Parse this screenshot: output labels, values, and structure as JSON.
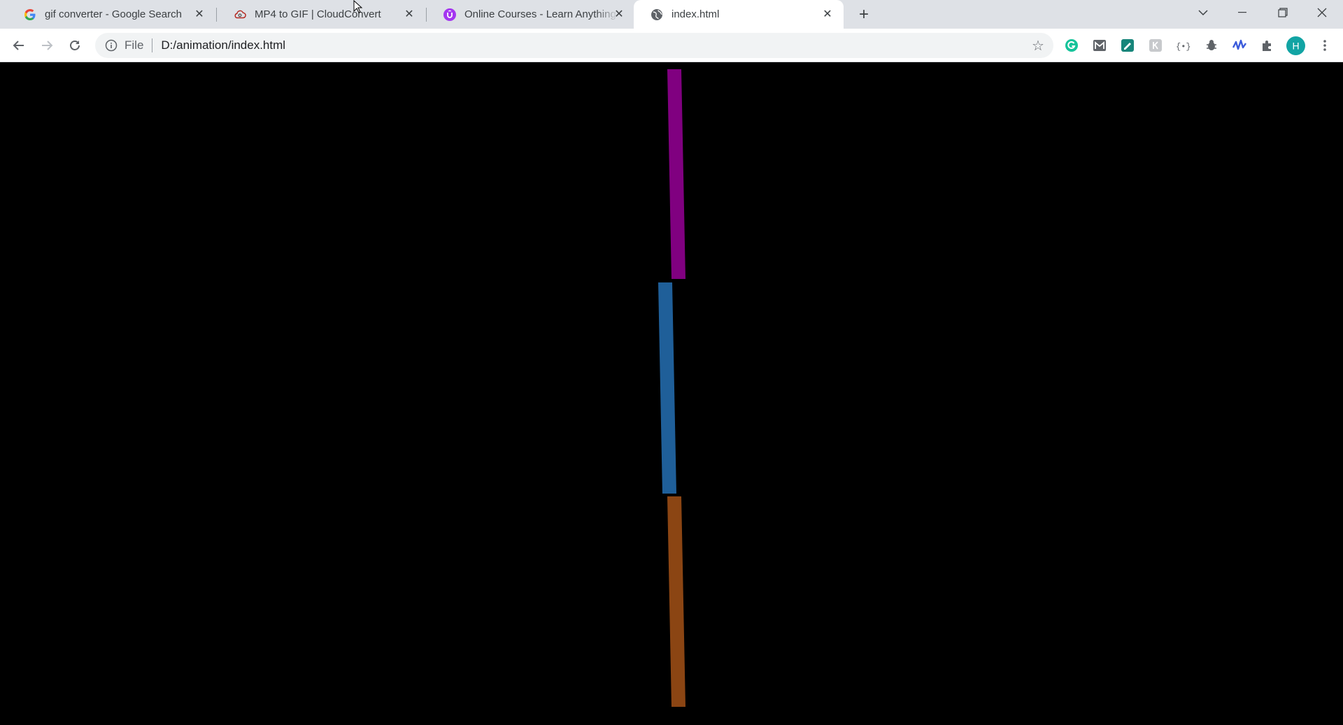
{
  "tabs": [
    {
      "title": "gif converter - Google Search",
      "favicon": "google-g-icon",
      "active": false
    },
    {
      "title": "MP4 to GIF | CloudConvert",
      "favicon": "cloud-icon",
      "active": false
    },
    {
      "title": "Online Courses - Learn Anything",
      "favicon": "udemy-icon",
      "active": false
    },
    {
      "title": "index.html",
      "favicon": "globe-icon",
      "active": true
    }
  ],
  "omnibox": {
    "scheme_label": "File",
    "url": "D:/animation/index.html"
  },
  "profile": {
    "initial": "H",
    "color": "#12a4a4"
  },
  "bars": [
    {
      "name": "magenta-bar",
      "color": "#800080"
    },
    {
      "name": "blue-bar",
      "color": "#1f5f99"
    },
    {
      "name": "orange-bar",
      "color": "#8b4513"
    }
  ]
}
